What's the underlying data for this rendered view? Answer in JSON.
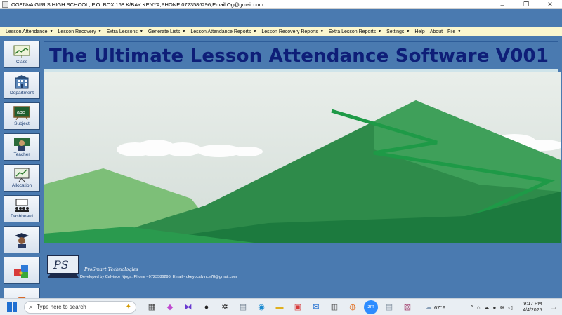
{
  "window": {
    "title": "OGENVA GIRLS HIGH SCHOOL, P.O. BOX 168 K/BAY KENYA,PHONE:0723586296,Email:Og@gmail.com",
    "minimize": "–",
    "maximize": "❐",
    "close": "✕"
  },
  "menu": {
    "items": [
      {
        "label": "Lesson Attendance",
        "caret": "▼"
      },
      {
        "label": "Lesson Recovery",
        "caret": "▼"
      },
      {
        "label": "Extra Lessons",
        "caret": "▼"
      },
      {
        "label": "Generate Lists",
        "caret": "▼"
      },
      {
        "label": "Lesson Attendance Reports",
        "caret": "▼"
      },
      {
        "label": "Lesson Recovery Reports",
        "caret": "▼"
      },
      {
        "label": "Extra Lesson Reports",
        "caret": "▼"
      },
      {
        "label": "Settings",
        "caret": "▼"
      },
      {
        "label": "Help",
        "caret": ""
      },
      {
        "label": "About",
        "caret": ""
      },
      {
        "label": "File",
        "caret": "▼"
      }
    ]
  },
  "sidebar": {
    "items": [
      {
        "label": "Class",
        "icon": "chart-board-icon"
      },
      {
        "label": "Department",
        "icon": "building-icon"
      },
      {
        "label": "Subject",
        "icon": "chalkboard-abc-icon"
      },
      {
        "label": "Teacher",
        "icon": "teacher-icon"
      },
      {
        "label": "Allocation",
        "icon": "allocation-board-icon"
      },
      {
        "label": "Dashboard",
        "icon": "presentation-icon"
      },
      {
        "label": "",
        "icon": "graduate-icon"
      },
      {
        "label": "",
        "icon": "puzzle-icon"
      },
      {
        "label": "",
        "icon": "globe-icon"
      }
    ]
  },
  "main": {
    "heading": "The Ultimate Lesson  Attendance Software V001"
  },
  "footer": {
    "logo_text": "PS",
    "brand": "ProSmart Technologies",
    "developer": "Developed by Calvince Njoga: Phone - 0723586296. Email - okeyocalvince78@gmail.com"
  },
  "taskbar": {
    "search_placeholder": "Type here to search",
    "weather": "67°F",
    "time": "9:17 PM",
    "date": "4/4/2025"
  },
  "colors": {
    "background_blue": "#4a7ab0",
    "menu_bg": "#fbf7cf",
    "heading_text": "#0e1e78",
    "sky": "#dfe8e4",
    "mountain_green": "#1f8a43"
  }
}
